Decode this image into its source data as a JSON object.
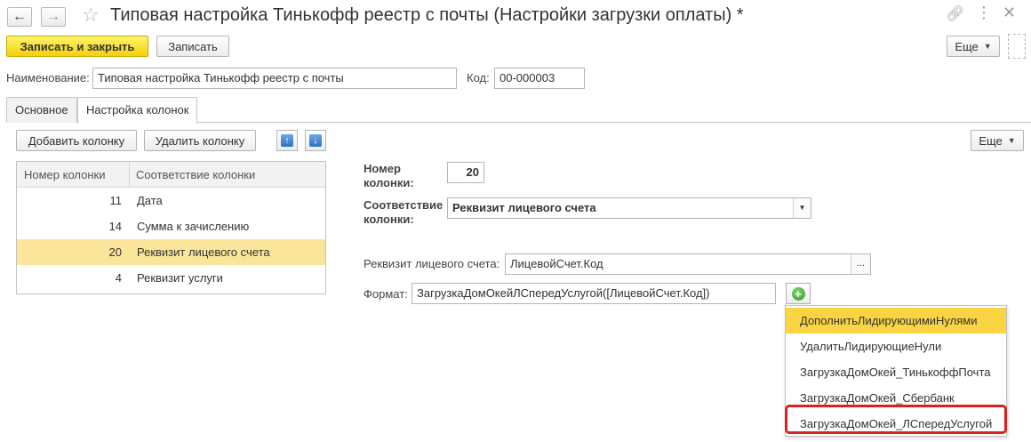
{
  "window": {
    "title": "Типовая настройка Тинькофф реестр с почты (Настройки загрузки оплаты) *",
    "icons": [
      "back-arrow-icon",
      "forward-arrow-icon",
      "star-icon",
      "link-icon",
      "more-icon",
      "close-icon"
    ]
  },
  "toolbar": {
    "save_close_label": "Записать и закрыть",
    "save_label": "Записать",
    "more_label": "Еще"
  },
  "header_fields": {
    "name_label": "Наименование:",
    "name_value": "Типовая настройка Тинькофф реестр с почты",
    "code_label": "Код:",
    "code_value": "00-000003"
  },
  "tabs": [
    {
      "label": "Основное",
      "active": false
    },
    {
      "label": "Настройка колонок",
      "active": true
    }
  ],
  "columns_toolbar": {
    "add_label": "Добавить колонку",
    "delete_label": "Удалить колонку",
    "more_label": "Еще"
  },
  "table": {
    "headers": [
      "Номер колонки",
      "Соответствие колонки"
    ],
    "rows": [
      {
        "num": "11",
        "name": "Дата",
        "selected": false
      },
      {
        "num": "14",
        "name": "Сумма к зачислению",
        "selected": false
      },
      {
        "num": "20",
        "name": "Реквизит лицевого счета",
        "selected": true
      },
      {
        "num": "4",
        "name": "Реквизит услуги",
        "selected": false
      }
    ]
  },
  "details": {
    "col_num_label_1": "Номер",
    "col_num_label_2": "колонки:",
    "col_num_value": "20",
    "match_label_1": "Соответствие",
    "match_label_2": "колонки:",
    "match_value": "Реквизит лицевого счета",
    "account_label": "Реквизит лицевого счета:",
    "account_value": "ЛицевойСчет.Код",
    "format_label": "Формат:",
    "format_value": "ЗагрузкаДомОкейЛСпередУслугой([ЛицевойСчет.Код])"
  },
  "popup": {
    "items": [
      {
        "label": "ДополнитьЛидирующимиНулями",
        "highlighted": true
      },
      {
        "label": "УдалитьЛидирующиеНули",
        "highlighted": false
      },
      {
        "label": "ЗагрузкаДомОкей_ТинькоффПочта",
        "highlighted": false
      },
      {
        "label": "ЗагрузкаДомОкей_Сбербанк",
        "highlighted": false
      },
      {
        "label": "ЗагрузкаДомОкей_ЛСпередУслугой",
        "highlighted": false
      }
    ]
  },
  "colors": {
    "primary_button": "#f4d10c",
    "selected_row": "#fbe59a",
    "popup_highlight": "#fbd443",
    "annotation_red": "#d82222"
  }
}
